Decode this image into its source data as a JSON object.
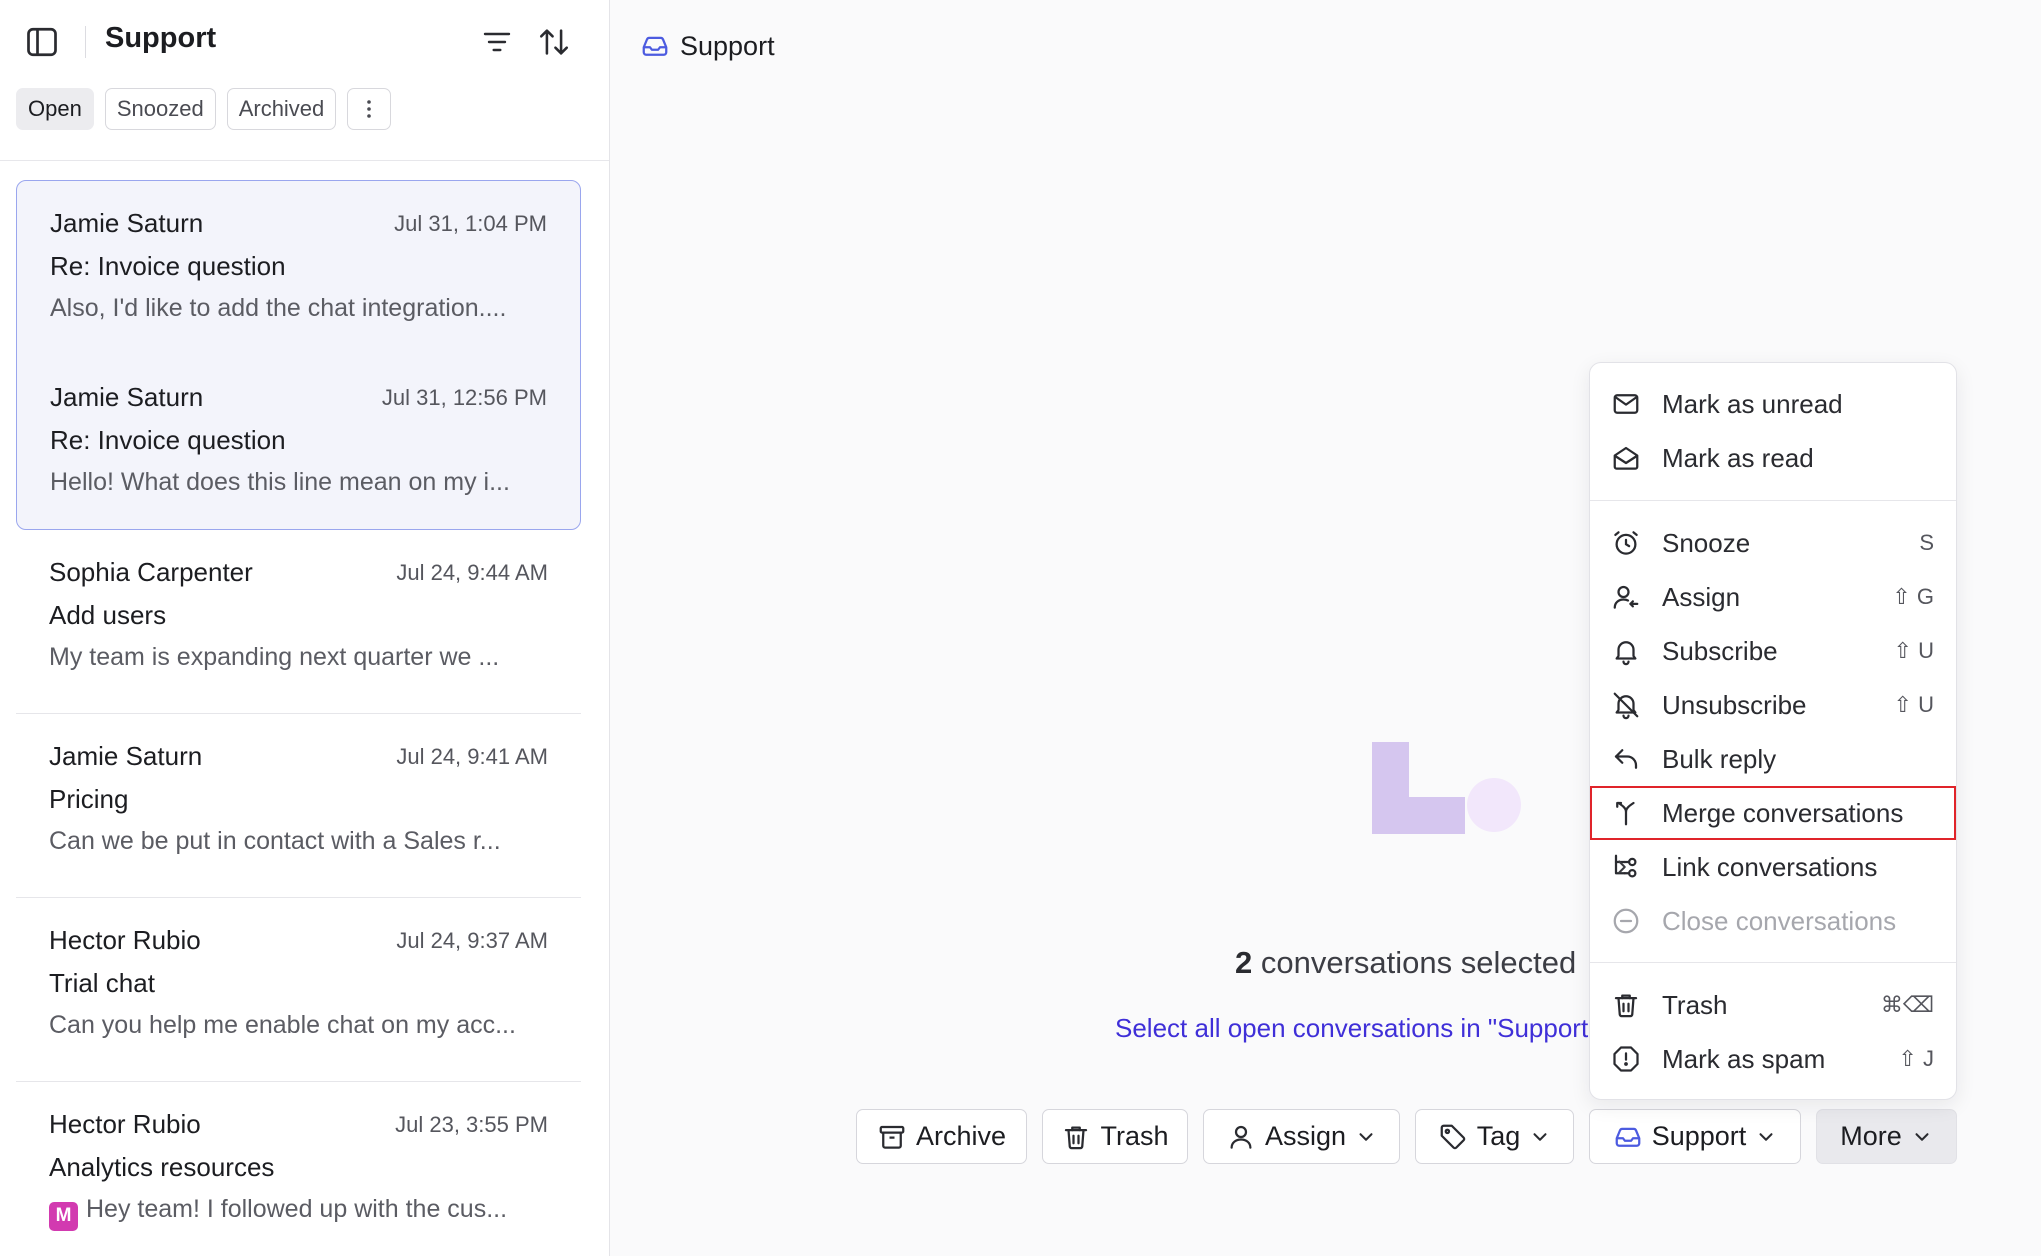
{
  "sidebar": {
    "title": "Support",
    "tabs": [
      {
        "label": "Open",
        "active": true
      },
      {
        "label": "Snoozed",
        "active": false
      },
      {
        "label": "Archived",
        "active": false
      }
    ],
    "conversations": [
      {
        "name": "Jamie Saturn",
        "time": "Jul 31, 1:04 PM",
        "subject": "Re: Invoice question",
        "preview": "Also, I'd like to add the chat integration....",
        "selected": true
      },
      {
        "name": "Jamie Saturn",
        "time": "Jul 31, 12:56 PM",
        "subject": "Re: Invoice question",
        "preview": "Hello! What does this line mean on my i...",
        "selected": true
      },
      {
        "name": "Sophia Carpenter",
        "time": "Jul 24, 9:44 AM",
        "subject": "Add users",
        "preview": "My team is expanding next quarter we ...",
        "selected": false
      },
      {
        "name": "Jamie Saturn",
        "time": "Jul 24, 9:41 AM",
        "subject": "Pricing",
        "preview": "Can we be put in contact with a Sales r...",
        "selected": false
      },
      {
        "name": "Hector Rubio",
        "time": "Jul 24, 9:37 AM",
        "subject": "Trial chat",
        "preview": "Can you help me enable chat on my acc...",
        "selected": false
      },
      {
        "name": "Hector Rubio",
        "time": "Jul 23, 3:55 PM",
        "subject": "Analytics resources",
        "preview": "Hey team! I followed up with the cus...",
        "badge": "M",
        "selected": false
      }
    ]
  },
  "main": {
    "header_title": "Support",
    "selected_count": "2",
    "selected_text": "conversations selected",
    "select_all_link": "Select all open conversations in \"Support\""
  },
  "actions": {
    "archive": "Archive",
    "trash": "Trash",
    "assign": "Assign",
    "tag": "Tag",
    "support": "Support",
    "more": "More"
  },
  "menu": {
    "mark_unread": "Mark as unread",
    "mark_read": "Mark as read",
    "snooze": "Snooze",
    "snooze_key": "S",
    "assign": "Assign",
    "assign_key": "⇧ G",
    "subscribe": "Subscribe",
    "subscribe_key": "⇧ U",
    "unsubscribe": "Unsubscribe",
    "unsubscribe_key": "⇧ U",
    "bulk_reply": "Bulk reply",
    "merge": "Merge conversations",
    "link": "Link conversations",
    "close": "Close conversations",
    "trash": "Trash",
    "trash_key": "⌘⌫",
    "spam": "Mark as spam",
    "spam_key": "⇧ J"
  },
  "colors": {
    "accent": "#4c5be0",
    "link": "#3f2fd8",
    "selected_border": "#9aa6ee",
    "highlight_outline": "#e0242a",
    "badge": "#d23ab0"
  }
}
